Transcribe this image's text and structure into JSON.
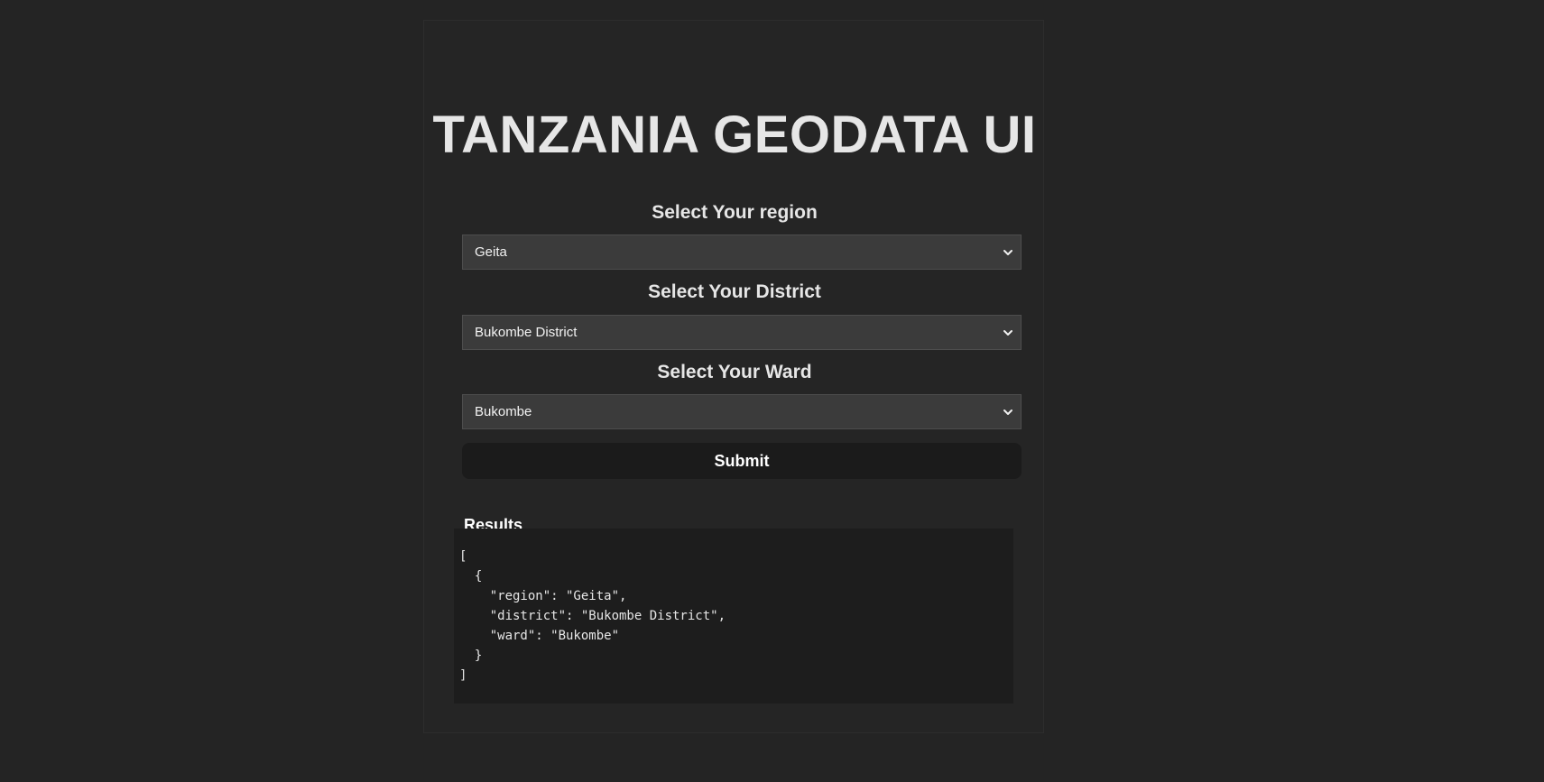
{
  "page": {
    "title": "TANZANIA GEODATA UI"
  },
  "form": {
    "region": {
      "label": "Select Your region",
      "selected": "Geita"
    },
    "district": {
      "label": "Select Your District",
      "selected": "Bukombe District"
    },
    "ward": {
      "label": "Select Your Ward",
      "selected": "Bukombe"
    },
    "submit_label": "Submit"
  },
  "results": {
    "label": "Results",
    "json_text": "[\n  {\n    \"region\": \"Geita\",\n    \"district\": \"Bukombe District\",\n    \"ward\": \"Bukombe\"\n  }\n]"
  },
  "colors": {
    "background": "#242424",
    "card": "#252525",
    "select_bg": "#3b3b3b",
    "button_bg": "#1b1b1b",
    "results_bg": "#1d1d1d",
    "text": "#e6e6e6"
  }
}
